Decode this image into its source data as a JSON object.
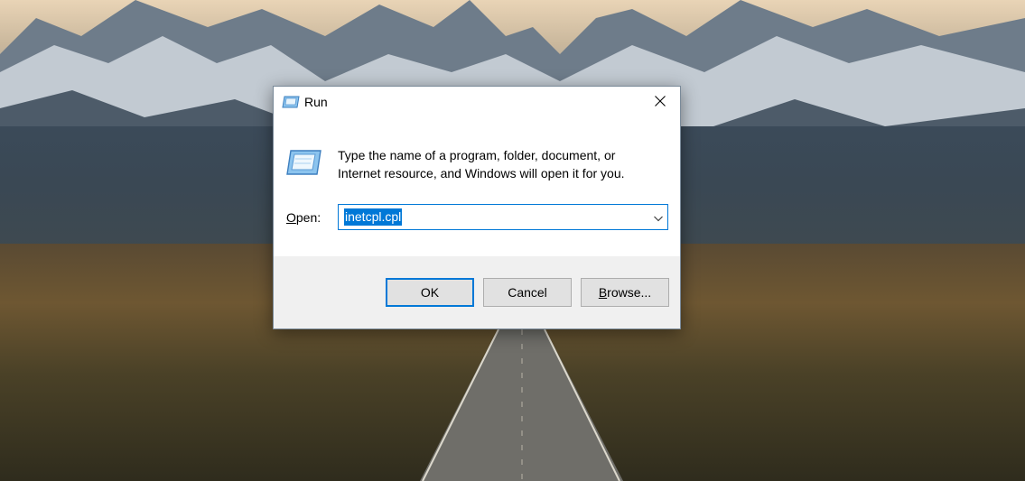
{
  "dialog": {
    "title": "Run",
    "description_line1": "Type the name of a program, folder, document, or",
    "description_line2": "Internet resource, and Windows will open it for you.",
    "open_label_accel": "O",
    "open_label_rest": "pen:",
    "open_value": "inetcpl.cpl",
    "buttons": {
      "ok": "OK",
      "cancel": "Cancel",
      "browse_accel": "B",
      "browse_rest": "rowse..."
    }
  },
  "icons": {
    "title": "run-icon",
    "body": "run-icon",
    "close": "close-icon",
    "dropdown": "chevron-down-icon"
  },
  "colors": {
    "accent": "#0078d7",
    "footer_bg": "#f0f0f0",
    "button_bg": "#e1e1e1",
    "button_border": "#adadad"
  }
}
